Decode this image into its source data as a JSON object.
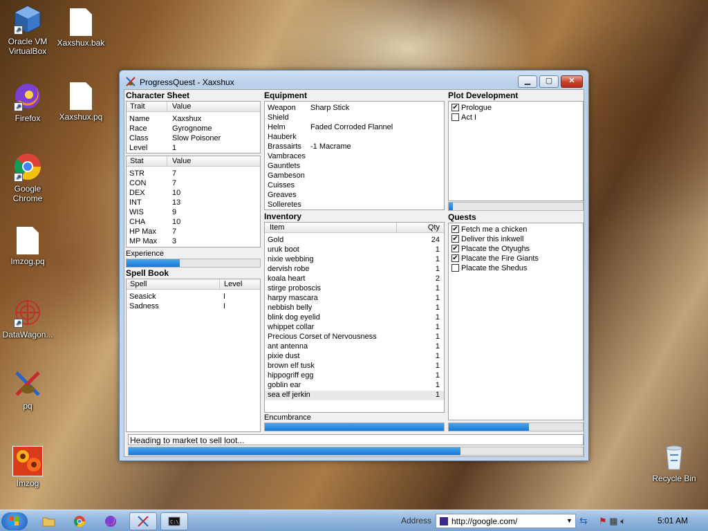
{
  "desktop": {
    "icons": [
      {
        "label": "Oracle VM VirtualBox",
        "icon": "virtualbox-icon"
      },
      {
        "label": "Xaxshux.bak",
        "icon": "file-icon"
      },
      {
        "label": "Firefox",
        "icon": "firefox-icon"
      },
      {
        "label": "Xaxshux.pq",
        "icon": "file-icon"
      },
      {
        "label": "Google Chrome",
        "icon": "chrome-icon"
      },
      {
        "label": "Imzog.pq",
        "icon": "file-icon"
      },
      {
        "label": "DataWagon...",
        "icon": "datawagon-icon"
      },
      {
        "label": "pq",
        "icon": "progressquest-icon"
      },
      {
        "label": "Imzog",
        "icon": "flower-image-icon"
      },
      {
        "label": "Recycle Bin",
        "icon": "recycle-bin-icon"
      }
    ]
  },
  "window": {
    "title": "ProgressQuest - Xaxshux",
    "character_sheet": {
      "title": "Character Sheet",
      "col_trait": "Trait",
      "col_value": "Value",
      "traits": [
        {
          "k": "Name",
          "v": "Xaxshux"
        },
        {
          "k": "Race",
          "v": "Gyrognome"
        },
        {
          "k": "Class",
          "v": "Slow Poisoner"
        },
        {
          "k": "Level",
          "v": "1"
        }
      ],
      "col_stat": "Stat",
      "col_stat_value": "Value",
      "stats": [
        {
          "k": "STR",
          "v": "7"
        },
        {
          "k": "CON",
          "v": "7"
        },
        {
          "k": "DEX",
          "v": "10"
        },
        {
          "k": "INT",
          "v": "13"
        },
        {
          "k": "WIS",
          "v": "9"
        },
        {
          "k": "CHA",
          "v": "10"
        },
        {
          "k": "HP Max",
          "v": "7"
        },
        {
          "k": "MP Max",
          "v": "3"
        }
      ],
      "experience_label": "Experience",
      "experience_progress": 0.4
    },
    "spell_book": {
      "title": "Spell Book",
      "col_spell": "Spell",
      "col_level": "Level",
      "spells": [
        {
          "k": "Seasick",
          "v": "I"
        },
        {
          "k": "Sadness",
          "v": "I"
        }
      ]
    },
    "equipment": {
      "title": "Equipment",
      "items": [
        {
          "k": "Weapon",
          "v": "Sharp Stick"
        },
        {
          "k": "Shield",
          "v": ""
        },
        {
          "k": "Helm",
          "v": "Faded Corroded Flannel"
        },
        {
          "k": "Hauberk",
          "v": ""
        },
        {
          "k": "Brassairts",
          "v": "-1 Macrame"
        },
        {
          "k": "Vambraces",
          "v": ""
        },
        {
          "k": "Gauntlets",
          "v": ""
        },
        {
          "k": "Gambeson",
          "v": ""
        },
        {
          "k": "Cuisses",
          "v": ""
        },
        {
          "k": "Greaves",
          "v": ""
        },
        {
          "k": "Solleretes",
          "v": ""
        }
      ]
    },
    "inventory": {
      "title": "Inventory",
      "col_item": "Item",
      "col_qty": "Qty",
      "items": [
        {
          "k": "Gold",
          "v": "24"
        },
        {
          "k": "uruk boot",
          "v": "1"
        },
        {
          "k": "nixie webbing",
          "v": "1"
        },
        {
          "k": "dervish robe",
          "v": "1"
        },
        {
          "k": "koala heart",
          "v": "2"
        },
        {
          "k": "stirge proboscis",
          "v": "1"
        },
        {
          "k": "harpy mascara",
          "v": "1"
        },
        {
          "k": "nebbish belly",
          "v": "1"
        },
        {
          "k": "blink dog eyelid",
          "v": "1"
        },
        {
          "k": "whippet collar",
          "v": "1"
        },
        {
          "k": "Precious Corset of Nervousness",
          "v": "1"
        },
        {
          "k": "ant antenna",
          "v": "1"
        },
        {
          "k": "pixie dust",
          "v": "1"
        },
        {
          "k": "brown elf tusk",
          "v": "1"
        },
        {
          "k": "hippogriff egg",
          "v": "1"
        },
        {
          "k": "goblin ear",
          "v": "1"
        },
        {
          "k": "sea elf jerkin",
          "v": "1"
        }
      ],
      "encumbrance_label": "Encumbrance",
      "encumbrance_progress": 1.0
    },
    "plot": {
      "title": "Plot Development",
      "items": [
        {
          "label": "Prologue",
          "checked": true
        },
        {
          "label": "Act I",
          "checked": false
        }
      ],
      "progress": 0.03
    },
    "quests": {
      "title": "Quests",
      "items": [
        {
          "label": "Fetch me a chicken",
          "checked": true
        },
        {
          "label": "Deliver this inkwell",
          "checked": true
        },
        {
          "label": "Placate the Otyughs",
          "checked": true
        },
        {
          "label": "Placate the Fire Giants",
          "checked": true
        },
        {
          "label": "Placate the Shedus",
          "checked": false
        }
      ],
      "progress": 0.6
    },
    "status_text": "Heading to market to sell loot...",
    "task_progress": 0.73
  },
  "taskbar": {
    "address_label": "Address",
    "address_value": "http://google.com/",
    "clock": "5:01 AM"
  }
}
